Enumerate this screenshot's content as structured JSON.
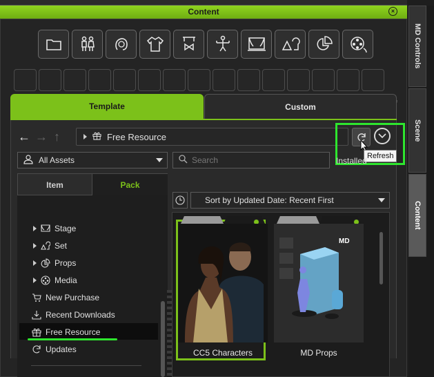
{
  "window": {
    "title": "Content"
  },
  "side_tabs": [
    {
      "label": "MD Controls",
      "active": false
    },
    {
      "label": "Scene",
      "active": false
    },
    {
      "label": "Content",
      "active": true
    }
  ],
  "toolbar_icons": [
    "folder-icon",
    "people-icon",
    "head-icon",
    "cloth-icon",
    "accessory-icon",
    "pose-icon",
    "stage-icon",
    "set-icon",
    "props-icon",
    "media-icon"
  ],
  "tabs": {
    "template": "Template",
    "custom": "Custom"
  },
  "nav": {
    "path": "Free Resource"
  },
  "tooltip": "Refresh",
  "filter": {
    "assets": "All Assets",
    "search_placeholder": "Search",
    "installed": "Installed"
  },
  "subtabs": {
    "item": "Item",
    "pack": "Pack"
  },
  "tree": {
    "stage": "Stage",
    "set": "Set",
    "props": "Props",
    "media": "Media",
    "new_purchase": "New Purchase",
    "recent_downloads": "Recent Downloads",
    "free_resource": "Free Resource",
    "updates": "Updates"
  },
  "sort": {
    "label": "Sort by Updated Date: Recent First"
  },
  "cards": [
    {
      "label": "CC5 Characters",
      "selected": true
    },
    {
      "label": "MD Props",
      "selected": false
    }
  ],
  "colors": {
    "accent": "#7cc11a",
    "highlight": "#2ee62e"
  }
}
